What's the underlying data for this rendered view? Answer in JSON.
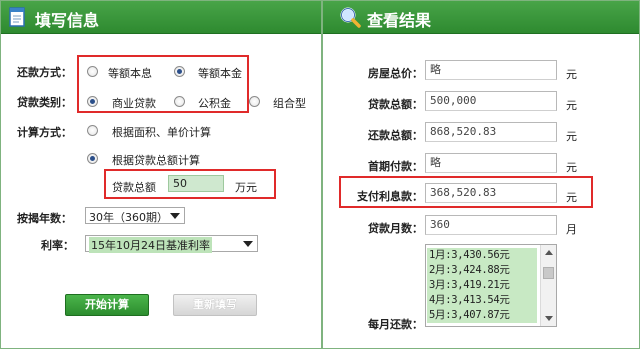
{
  "left_panel": {
    "title": "填写信息",
    "repayment_method": {
      "label": "还款方式：",
      "options": [
        {
          "label": "等额本息",
          "selected": false
        },
        {
          "label": "等额本金",
          "selected": true
        }
      ]
    },
    "loan_type": {
      "label": "贷款类别：",
      "options": [
        {
          "label": "商业贷款",
          "selected": true
        },
        {
          "label": "公积金",
          "selected": false
        },
        {
          "label": "组合型",
          "selected": false
        }
      ]
    },
    "calc_method": {
      "label": "计算方式：",
      "options": [
        {
          "label": "根据面积、单价计算",
          "selected": false
        },
        {
          "label": "根据贷款总额计算",
          "selected": true
        }
      ]
    },
    "loan_total": {
      "label": "贷款总额",
      "value": "50",
      "unit": "万元"
    },
    "mortgage_years": {
      "label": "按揭年数：",
      "selected": "30年（360期）"
    },
    "interest_rate": {
      "label": "利率：",
      "selected": "15年10月24日基准利率"
    },
    "buttons": {
      "calculate": "开始计算",
      "reset": "重新填写"
    }
  },
  "right_panel": {
    "title": "查看结果",
    "rows": [
      {
        "label": "房屋总价：",
        "value": "略",
        "unit": "元"
      },
      {
        "label": "贷款总额：",
        "value": "500,000",
        "unit": "元"
      },
      {
        "label": "还款总额：",
        "value": "868,520.83",
        "unit": "元"
      },
      {
        "label": "首期付款：",
        "value": "略",
        "unit": "元"
      },
      {
        "label": "支付利息款：",
        "value": "368,520.83",
        "unit": "元"
      },
      {
        "label": "贷款月数：",
        "value": "360",
        "unit": "月"
      }
    ],
    "monthly": {
      "label": "每月还款：",
      "items": [
        "1月:3,430.56元",
        "2月:3,424.88元",
        "3月:3,419.21元",
        "4月:3,413.54元",
        "5月:3,407.87元"
      ]
    }
  },
  "colors": {
    "header_green": "#2e8a30",
    "highlight_red": "#e02a2a",
    "input_green": "#cfe8cf"
  },
  "icons": {
    "left_header": "form-document-icon",
    "right_header": "magnifier-search-icon"
  }
}
